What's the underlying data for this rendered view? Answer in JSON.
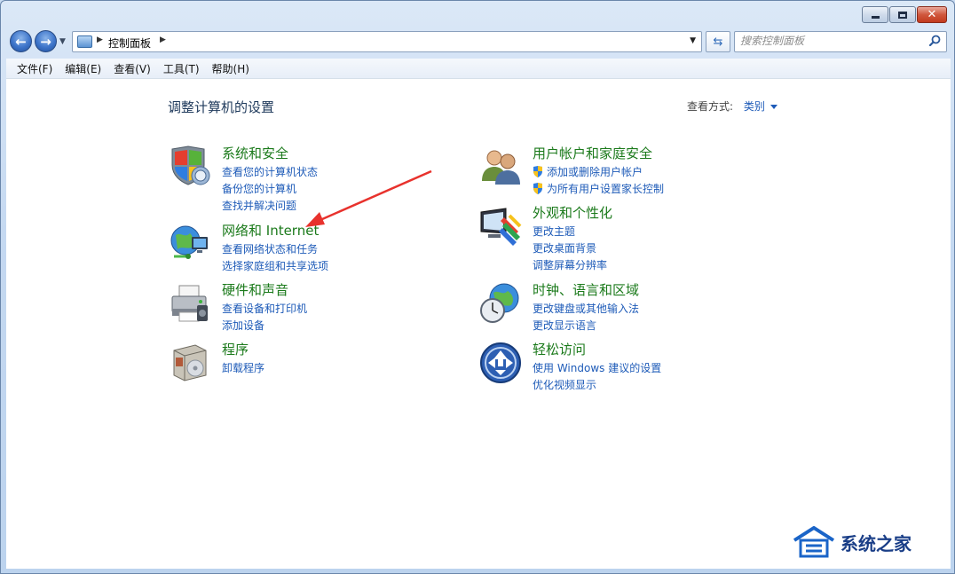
{
  "window": {
    "minimize_label": "",
    "maximize_label": "",
    "close_symbol": "✕"
  },
  "nav": {
    "back_symbol": "←",
    "forward_symbol": "→",
    "address_path": "控制面板",
    "refresh_symbol": "⇆",
    "search_placeholder": "搜索控制面板"
  },
  "menu": [
    "文件(F)",
    "编辑(E)",
    "查看(V)",
    "工具(T)",
    "帮助(H)"
  ],
  "page": {
    "title": "调整计算机的设置",
    "view_label": "查看方式:",
    "view_value": "类别"
  },
  "categories": [
    {
      "icon": "security-shield-icon",
      "title": "系统和安全",
      "links": [
        "查看您的计算机状态",
        "备份您的计算机",
        "查找并解决问题"
      ]
    },
    {
      "icon": "network-globe-icon",
      "title": "网络和 Internet",
      "links": [
        "查看网络状态和任务",
        "选择家庭组和共享选项"
      ]
    },
    {
      "icon": "printer-icon",
      "title": "硬件和声音",
      "links": [
        "查看设备和打印机",
        "添加设备"
      ]
    },
    {
      "icon": "programs-box-icon",
      "title": "程序",
      "links": [
        "卸载程序"
      ]
    },
    {
      "icon": "users-icon",
      "title": "用户帐户和家庭安全",
      "links": [
        "添加或删除用户帐户",
        "为所有用户设置家长控制"
      ]
    },
    {
      "icon": "monitor-palette-icon",
      "title": "外观和个性化",
      "links": [
        "更改主题",
        "更改桌面背景",
        "调整屏幕分辨率"
      ]
    },
    {
      "icon": "clock-globe-icon",
      "title": "时钟、语言和区域",
      "links": [
        "更改键盘或其他输入法",
        "更改显示语言"
      ]
    },
    {
      "icon": "ease-of-access-icon",
      "title": "轻松访问",
      "links": [
        "使用 Windows 建议的设置",
        "优化视频显示"
      ]
    }
  ],
  "watermark": {
    "text": "系统之家"
  },
  "colors": {
    "link": "#1e5bb8",
    "category_title": "#1b7a1b",
    "annotation_arrow": "#e8322d",
    "frame": "#c5d9f1"
  }
}
